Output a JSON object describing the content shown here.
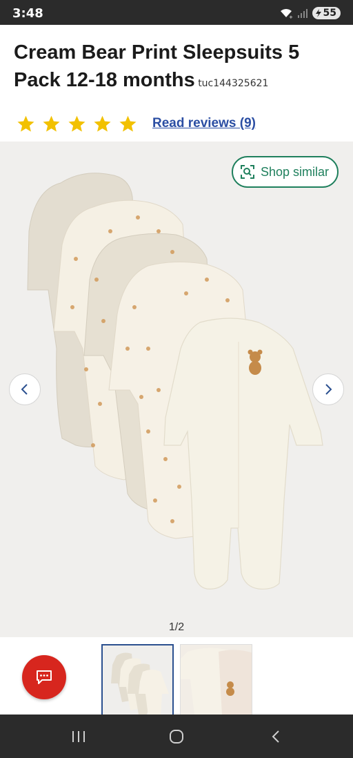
{
  "status_bar": {
    "time": "3:48",
    "battery": "55",
    "icons": [
      "wifi-icon",
      "signal-icon",
      "battery-icon"
    ]
  },
  "product": {
    "title": "Cream Bear Print Sleepsuits 5 Pack 12-18 months",
    "sku": "tuc144325621",
    "rating": {
      "stars": 5,
      "max": 5,
      "star_color": "#f2c100",
      "reviews_label": "Read reviews (9)"
    }
  },
  "gallery": {
    "shop_similar_label": "Shop similar",
    "pager": "1/2",
    "current_image": 1,
    "total_images": 2,
    "accent_color": "#1e7f5c"
  },
  "thumbnails": [
    {
      "name": "thumbnail-1",
      "selected": true
    },
    {
      "name": "thumbnail-2",
      "selected": false
    }
  ],
  "chat": {
    "icon": "chat-icon",
    "color": "#d7261e"
  },
  "nav_bar": {
    "buttons": [
      "recent-apps-icon",
      "home-icon",
      "back-icon"
    ]
  }
}
